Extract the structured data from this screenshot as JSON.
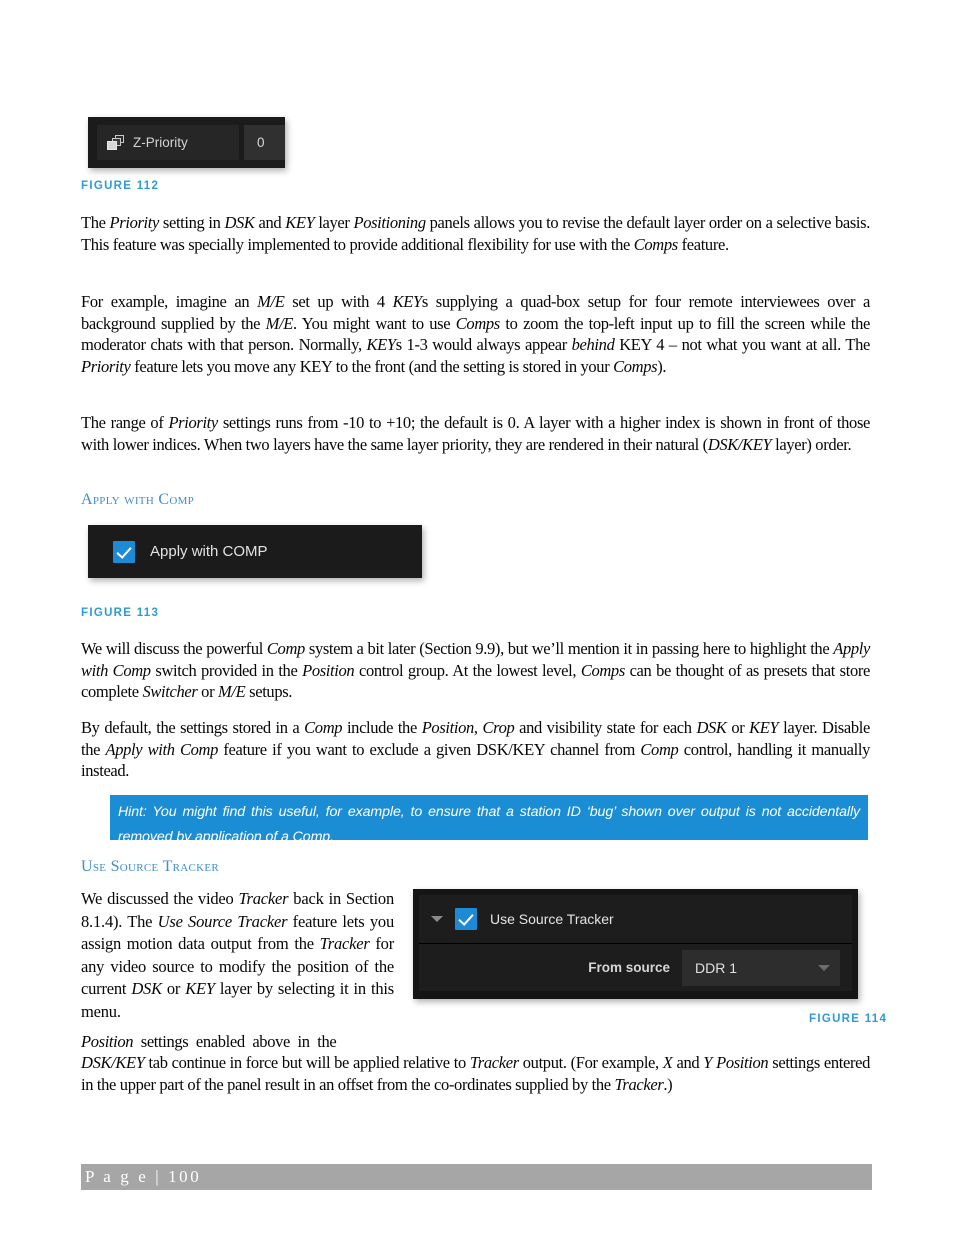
{
  "figure_112": {
    "caption": "FIGURE 112",
    "widget": {
      "icon": "layers-icon",
      "label": "Z-Priority",
      "value": "0"
    }
  },
  "figure_113": {
    "caption": "FIGURE 113",
    "widget": {
      "checkbox_checked": true,
      "label": "Apply with COMP"
    }
  },
  "figure_114": {
    "caption": "FIGURE 114",
    "widget": {
      "caret": "chevron-down-icon",
      "checkbox_checked": true,
      "label": "Use Source Tracker",
      "from_source_label": "From source",
      "from_source_value": "DDR 1"
    }
  },
  "headings": {
    "apply_with_comp": "Apply with Comp",
    "use_source_tracker": "Use Source Tracker"
  },
  "paragraphs": {
    "p1": "The <i>Priority</i> setting in <i>DSK</i> and <i>KEY</i> layer <i>Positioning</i> panels allows you to revise the default layer order on a selective basis. This feature was specially implemented to provide additional flexibility for use with the <i>Comps</i> feature.",
    "p2": "For example, imagine an <i>M/E</i> set up with 4 <i>KEY</i>s supplying a quad-box setup for four remote interviewees over a background supplied by the <i>M/E</i>.  You might want to use <i>Comps</i> to zoom the top-left input up to fill the screen while the moderator chats with that person. Normally, <i>KEY</i>s 1-3 would always appear <i>behind</i> KEY 4 &ndash; not what you want at all.  The <i>Priority</i> feature lets you move any KEY to the front (and the setting is stored in your <i>Comps</i>).",
    "p3": "The range of <i>Priority</i> settings runs from -10 to +10; the default is 0. A layer with a higher index is shown in front of those with lower indices.  When two layers have the same layer priority, they are rendered in their natural (<i>DSK/KEY</i> layer) order.",
    "p4": "We will discuss the powerful <i>Comp</i> system a bit later (Section 9.9), but we&rsquo;ll mention it in passing here to highlight the <i>Apply with Comp</i> switch provided in the <i>Position</i> control group.  At the lowest level, <i>Comps</i> can be thought of as presets that store complete <i>Switcher</i> or <i>M/E</i> setups.",
    "p5": "By default, the settings stored in a <i>Comp</i> include the <i>Position</i>, <i>Crop</i> and visibility state for each <i>DSK</i> or <i>KEY</i> layer.  Disable the <i>Apply with Comp</i> feature if you want to exclude a given DSK/KEY channel from <i>Comp</i> control, handling it manually instead.",
    "p6": "We discussed the video <i>Tracker</i> back in Section 8.1.4).  The <i>Use Source Tracker</i> feature lets you assign motion data output from the <i>Tracker</i> for any video source to modify the position of the current <i>DSK</i> or <i>KEY</i> layer by selecting it in this menu.",
    "p7_line1": "<i>Position</i>&nbsp; settings&nbsp; enabled&nbsp; above&nbsp; in&nbsp; the",
    "p7_rest": "<i>DSK/KEY</i> tab continue in force but will be applied relative to <i>Tracker</i> output.  (For example, <i>X</i> and <i>Y Position</i> settings entered in the upper part of the panel result in an offset from the co-ordinates supplied by the <i>Tracker</i>.)"
  },
  "hint": {
    "text": "Hint: You might find this useful, for example, to ensure that a station ID &lsquo;bug&rsquo; shown over output is not accidentally removed by application of a Comp."
  },
  "footer": {
    "page_label": "P a g e  | 100"
  },
  "colors": {
    "accent_blue": "#2e9bd6",
    "heading_blue": "#3f8ecb",
    "hint_blue": "#1b8dd4",
    "footer_gray": "#a6a6a6",
    "widget_dark": "#1b1b1b"
  }
}
